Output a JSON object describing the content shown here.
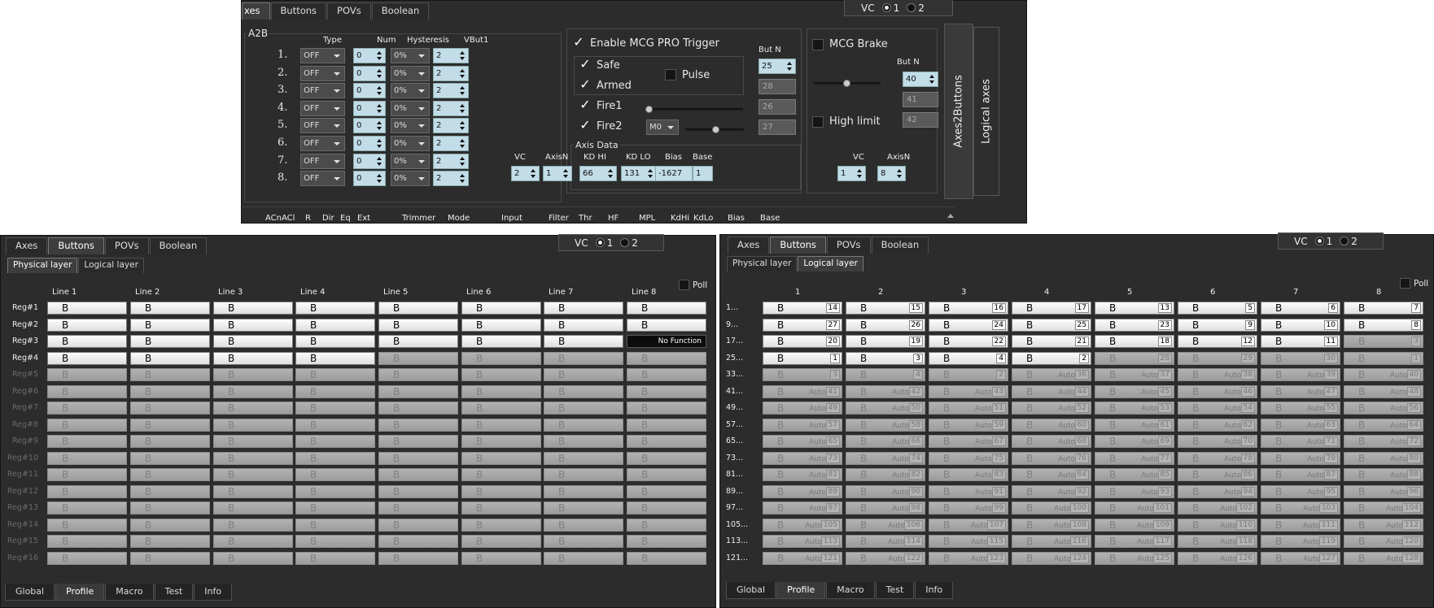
{
  "top": {
    "tabs": [
      "xes",
      "Buttons",
      "POVs",
      "Boolean"
    ],
    "vc": {
      "label": "VC",
      "options": [
        "1",
        "2"
      ],
      "selected": "1"
    },
    "a2b": {
      "title": "A2B",
      "headers": [
        "Type",
        "Num",
        "Hysteresis",
        "VBut1"
      ],
      "rows": [
        {
          "n": "1.",
          "type": "OFF",
          "num": "0",
          "hyst": "0%",
          "vbut": "2"
        },
        {
          "n": "2.",
          "type": "OFF",
          "num": "0",
          "hyst": "0%",
          "vbut": "2"
        },
        {
          "n": "3.",
          "type": "OFF",
          "num": "0",
          "hyst": "0%",
          "vbut": "2"
        },
        {
          "n": "4.",
          "type": "OFF",
          "num": "0",
          "hyst": "0%",
          "vbut": "2"
        },
        {
          "n": "5.",
          "type": "OFF",
          "num": "0",
          "hyst": "0%",
          "vbut": "2"
        },
        {
          "n": "6.",
          "type": "OFF",
          "num": "0",
          "hyst": "0%",
          "vbut": "2"
        },
        {
          "n": "7.",
          "type": "OFF",
          "num": "0",
          "hyst": "0%",
          "vbut": "2"
        },
        {
          "n": "8.",
          "type": "OFF",
          "num": "0",
          "hyst": "0%",
          "vbut": "2"
        }
      ]
    },
    "mcg": {
      "enable_label": "Enable MCG PRO Trigger",
      "but_n_label": "But N",
      "safe": "Safe",
      "armed": "Armed",
      "fire1": "Fire1",
      "fire2": "Fire2",
      "pulse": "Pulse",
      "but_values": [
        "25",
        "28",
        "26",
        "27"
      ],
      "fire2_combo": "M0",
      "axis_data_title": "Axis Data",
      "axis_headers": [
        "VC",
        "AxisN",
        "KD HI",
        "KD LO",
        "Bias",
        "Base"
      ],
      "axis_values": [
        "2",
        "1",
        "66",
        "131",
        "-1627",
        "1"
      ]
    },
    "brake": {
      "label": "MCG Brake",
      "but_n_label": "But N",
      "but_values": [
        "40",
        "41",
        "42"
      ],
      "high_limit": "High limit",
      "vc_label": "VC",
      "axisn_label": "AxisN",
      "vc_value": "1",
      "axisn_value": "8"
    },
    "vtabs": [
      "Axes2Buttons",
      "Logical axes"
    ],
    "bottom_headers": [
      "ACn",
      "ACl",
      "R",
      "Dir",
      "Eq",
      "Ext",
      "Trimmer",
      "Mode",
      "Input",
      "Filter",
      "Thr",
      "HF",
      "MPL",
      "KdHi",
      "KdLo",
      "Bias",
      "Base"
    ]
  },
  "left": {
    "tabs": [
      "Axes",
      "Buttons",
      "POVs",
      "Boolean"
    ],
    "vc": {
      "label": "VC",
      "options": [
        "1",
        "2"
      ],
      "selected": "1"
    },
    "subtabs": [
      "Physical layer",
      "Logical layer"
    ],
    "poll": "Poll",
    "col_headers": [
      "Line 1",
      "Line 2",
      "Line 3",
      "Line 4",
      "Line 5",
      "Line 6",
      "Line 7",
      "Line 8"
    ],
    "rows": [
      "Reg#1",
      "Reg#2",
      "Reg#3",
      "Reg#4",
      "Reg#5",
      "Reg#6",
      "Reg#7",
      "Reg#8",
      "Reg#9",
      "Reg#10",
      "Reg#11",
      "Reg#12",
      "Reg#13",
      "Reg#14",
      "Reg#15",
      "Reg#16"
    ],
    "cell_text": "B",
    "no_function": "No Function",
    "bottom_tabs": [
      "Global",
      "Profile",
      "Macro",
      "Test",
      "Info"
    ]
  },
  "right": {
    "tabs": [
      "Axes",
      "Buttons",
      "POVs",
      "Boolean"
    ],
    "vc": {
      "label": "VC",
      "options": [
        "1",
        "2"
      ],
      "selected": "1"
    },
    "subtabs": [
      "Physical layer",
      "Logical layer"
    ],
    "poll": "Poll",
    "col_headers": [
      "1",
      "2",
      "3",
      "4",
      "5",
      "6",
      "7",
      "8"
    ],
    "rows": [
      "1...",
      "9...",
      "17...",
      "25...",
      "33...",
      "41...",
      "49...",
      "57...",
      "65...",
      "73...",
      "81...",
      "89...",
      "97...",
      "105...",
      "113...",
      "121..."
    ],
    "cell_text": "B",
    "auto_text": "Auto",
    "numbers": [
      [
        14,
        15,
        16,
        17,
        13,
        5,
        6,
        7
      ],
      [
        27,
        26,
        24,
        25,
        23,
        9,
        10,
        8
      ],
      [
        20,
        19,
        22,
        21,
        18,
        12,
        11,
        3
      ],
      [
        1,
        3,
        4,
        2,
        28,
        29,
        30,
        1
      ],
      [
        3,
        4,
        2,
        36,
        37,
        38,
        39,
        40
      ],
      [
        41,
        42,
        43,
        44,
        45,
        46,
        47,
        48
      ],
      [
        49,
        50,
        51,
        52,
        53,
        54,
        55,
        56
      ],
      [
        57,
        58,
        59,
        60,
        61,
        62,
        63,
        64
      ],
      [
        65,
        66,
        67,
        68,
        69,
        70,
        71,
        72
      ],
      [
        73,
        74,
        75,
        76,
        77,
        78,
        79,
        80
      ],
      [
        81,
        82,
        83,
        84,
        85,
        86,
        87,
        88
      ],
      [
        89,
        90,
        91,
        92,
        93,
        94,
        95,
        96
      ],
      [
        97,
        98,
        99,
        100,
        101,
        102,
        103,
        104
      ],
      [
        105,
        106,
        107,
        108,
        109,
        110,
        111,
        112
      ],
      [
        113,
        114,
        115,
        116,
        117,
        118,
        119,
        120
      ],
      [
        121,
        122,
        123,
        124,
        125,
        126,
        127,
        128
      ]
    ],
    "bottom_tabs": [
      "Global",
      "Profile",
      "Macro",
      "Test",
      "Info"
    ]
  }
}
